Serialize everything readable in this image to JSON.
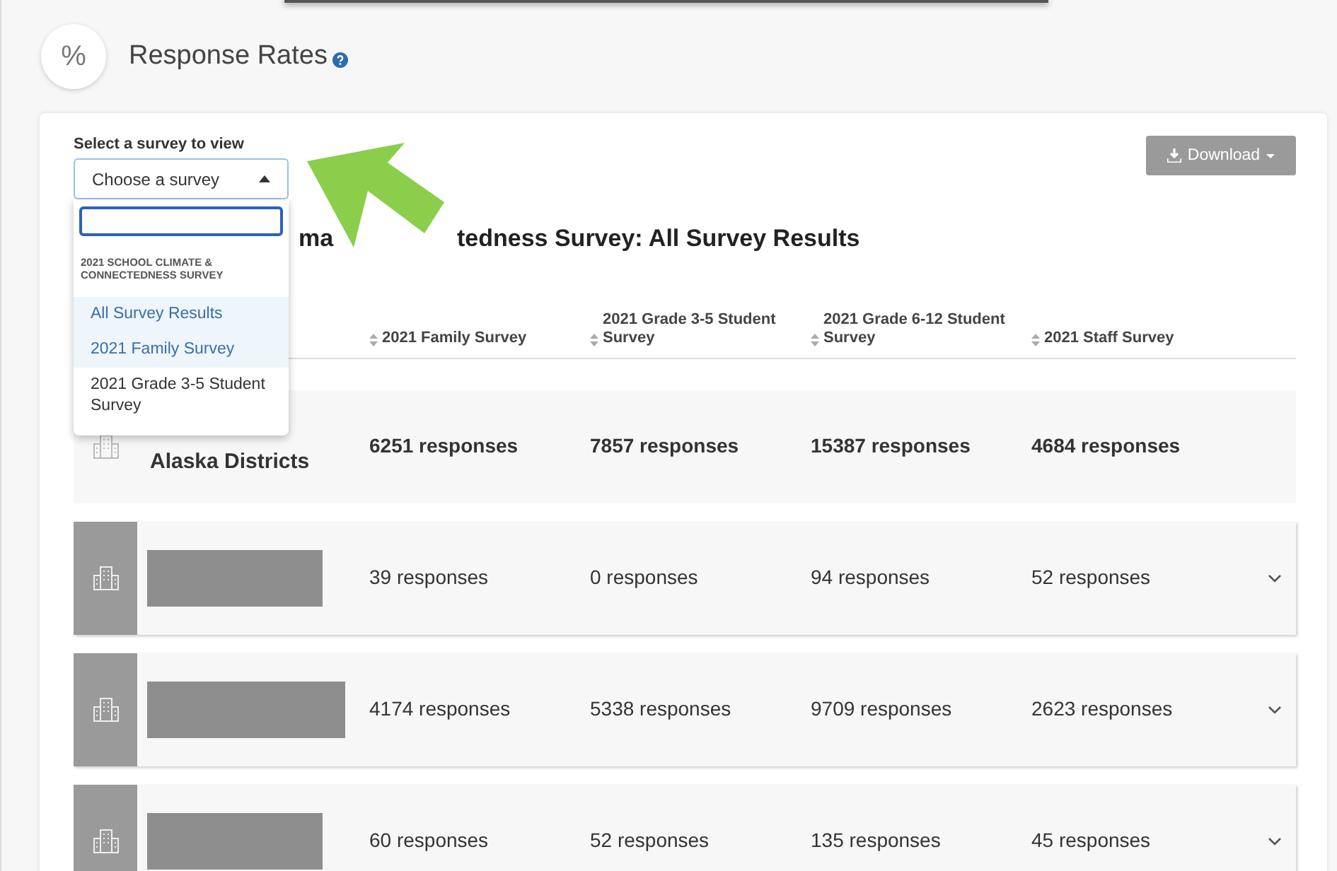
{
  "header": {
    "icon": "%",
    "title": "Response Rates"
  },
  "selector": {
    "label": "Select a survey to view",
    "value": "Choose a survey",
    "expanded": true,
    "group_label": "2021 SCHOOL CLIMATE & CONNECTEDNESS SURVEY",
    "options": [
      {
        "label": "All Survey Results",
        "highlighted": true
      },
      {
        "label": "2021 Family Survey",
        "highlighted": true
      },
      {
        "label": "2021 Grade 3-5 Student Survey",
        "highlighted": false
      }
    ]
  },
  "download_button": {
    "label": "Download"
  },
  "heading_fragments": [
    "ma",
    "tedness Survey: All Survey Results"
  ],
  "table": {
    "columns": [
      {
        "label": "2021 Family Survey",
        "sortable": true
      },
      {
        "label": "2021 Grade 3-5 Student Survey",
        "sortable": true
      },
      {
        "label": "2021 Grade 6-12 Student Survey",
        "sortable": true
      },
      {
        "label": "2021 Staff Survey",
        "sortable": true
      }
    ],
    "rows": [
      {
        "kind": "total",
        "name": "Alaska Districts",
        "cells": [
          "6251 responses",
          "7857 responses",
          "15387 responses",
          "4684 responses"
        ]
      },
      {
        "kind": "district",
        "name_redacted": true,
        "cells": [
          "39 responses",
          "0 responses",
          "94 responses",
          "52 responses"
        ],
        "expanded": false
      },
      {
        "kind": "district",
        "name_redacted": true,
        "cells": [
          "4174 responses",
          "5338 responses",
          "9709 responses",
          "2623 responses"
        ],
        "expanded": false
      },
      {
        "kind": "district",
        "name_redacted": true,
        "cells": [
          "60 responses",
          "52 responses",
          "135 responses",
          "45 responses"
        ],
        "expanded": false
      }
    ]
  }
}
